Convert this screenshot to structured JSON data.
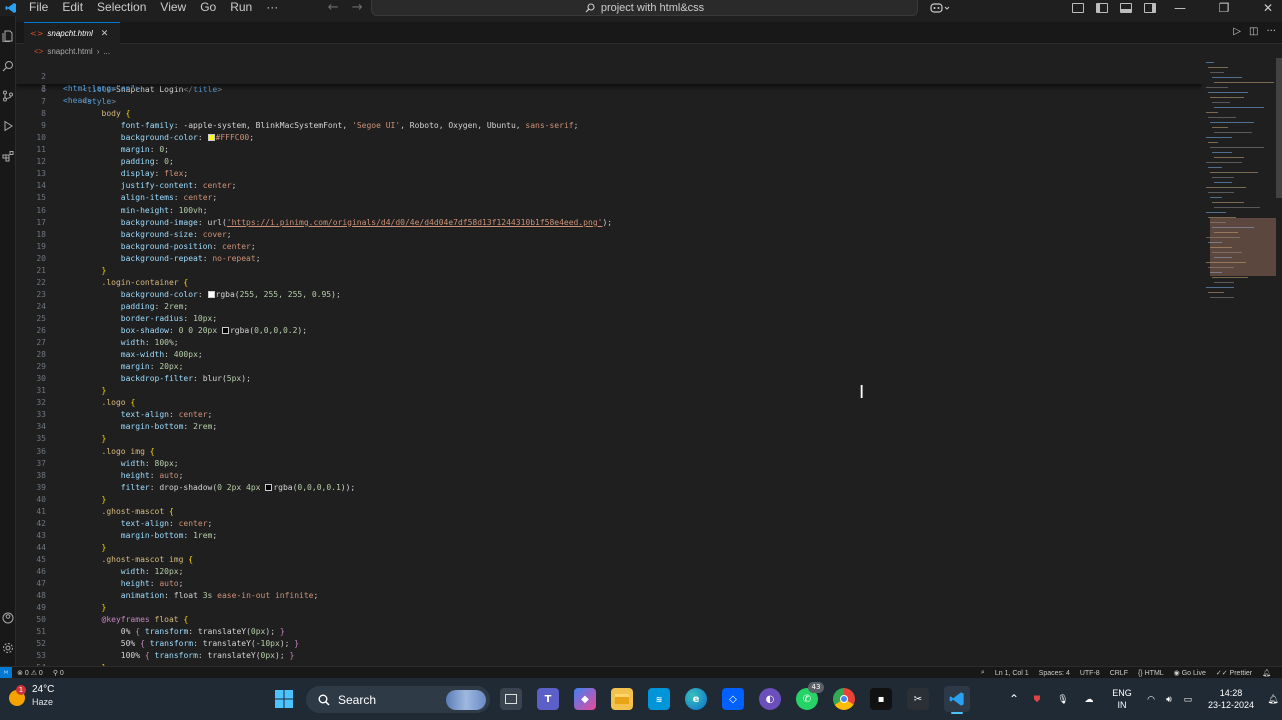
{
  "menu": [
    "File",
    "Edit",
    "Selection",
    "View",
    "Go",
    "Run"
  ],
  "command_center": {
    "title": "project with html&css"
  },
  "tab": {
    "filename": "snapcht.html"
  },
  "breadcrumb": [
    "snapcht.html",
    "›",
    "..."
  ],
  "sticky_lines": [
    {
      "ln": "2",
      "code": "<html lang=\"en\">"
    },
    {
      "ln": "3",
      "code": "<head>"
    }
  ],
  "lines": [
    {
      "ln": "6",
      "html": "    <span class='t'>&lt;</span><span class='tg'>title</span><span class='t'>&gt;</span><span class='plain'>Snapchat Login</span><span class='t'>&lt;/</span><span class='tg'>title</span><span class='t'>&gt;</span>"
    },
    {
      "ln": "7",
      "html": "    <span class='t'>&lt;</span><span class='tg'>style</span><span class='t'>&gt;</span>"
    },
    {
      "ln": "8",
      "html": "        <span class='s'>body</span> <span class='b'>{</span>"
    },
    {
      "ln": "9",
      "html": "            <span class='p'>font-family</span>: <span class='plain'>-apple-system, BlinkMacSystemFont, </span><span class='v'>'Segoe UI'</span><span class='plain'>, Roboto, Oxygen, Ubuntu, </span><span class='v'>sans-serif</span>;"
    },
    {
      "ln": "10",
      "html": "            <span class='p'>background-color</span>: <span class='sw' style='background:#FFFC00'></span><span class='v'>#FFFC00</span>;"
    },
    {
      "ln": "11",
      "html": "            <span class='p'>margin</span>: <span class='n'>0</span>;"
    },
    {
      "ln": "12",
      "html": "            <span class='p'>padding</span>: <span class='n'>0</span>;"
    },
    {
      "ln": "13",
      "html": "            <span class='p'>display</span>: <span class='v'>flex</span>;"
    },
    {
      "ln": "14",
      "html": "            <span class='p'>justify-content</span>: <span class='v'>center</span>;"
    },
    {
      "ln": "15",
      "html": "            <span class='p'>align-items</span>: <span class='v'>center</span>;"
    },
    {
      "ln": "16",
      "html": "            <span class='p'>min-height</span>: <span class='n'>100vh</span>;"
    },
    {
      "ln": "17",
      "html": "            <span class='p'>background-image</span>: <span class='plain'>url(</span><span class='u'>'https://i.pinimg.com/originals/d4/d0/4e/d4d04e7df58d13f1244310b1f58e4eed.png'</span><span class='plain'>)</span>;"
    },
    {
      "ln": "18",
      "html": "            <span class='p'>background-size</span>: <span class='v'>cover</span>;"
    },
    {
      "ln": "19",
      "html": "            <span class='p'>background-position</span>: <span class='v'>center</span>;"
    },
    {
      "ln": "20",
      "html": "            <span class='p'>background-repeat</span>: <span class='v'>no-repeat</span>;"
    },
    {
      "ln": "21",
      "html": "        <span class='b'>}</span>"
    },
    {
      "ln": "22",
      "html": "        <span class='s'>.login-container</span> <span class='b'>{</span>"
    },
    {
      "ln": "23",
      "html": "            <span class='p'>background-color</span>: <span class='sw' style='background:#ffffff'></span><span class='plain'>rgba(</span><span class='n'>255, 255, 255, 0.95</span><span class='plain'>)</span>;"
    },
    {
      "ln": "24",
      "html": "            <span class='p'>padding</span>: <span class='n'>2rem</span>;"
    },
    {
      "ln": "25",
      "html": "            <span class='p'>border-radius</span>: <span class='n'>10px</span>;"
    },
    {
      "ln": "26",
      "html": "            <span class='p'>box-shadow</span>: <span class='n'>0 0 20px</span> <span class='sw' style='background:#000'></span><span class='plain'>rgba(</span><span class='n'>0,0,0,0.2</span><span class='plain'>)</span>;"
    },
    {
      "ln": "27",
      "html": "            <span class='p'>width</span>: <span class='n'>100%</span>;"
    },
    {
      "ln": "28",
      "html": "            <span class='p'>max-width</span>: <span class='n'>400px</span>;"
    },
    {
      "ln": "29",
      "html": "            <span class='p'>margin</span>: <span class='n'>20px</span>;"
    },
    {
      "ln": "30",
      "html": "            <span class='p'>backdrop-filter</span>: <span class='plain'>blur(</span><span class='n'>5px</span><span class='plain'>)</span>;"
    },
    {
      "ln": "31",
      "html": "        <span class='b'>}</span>"
    },
    {
      "ln": "32",
      "html": "        <span class='s'>.logo</span> <span class='b'>{</span>"
    },
    {
      "ln": "33",
      "html": "            <span class='p'>text-align</span>: <span class='v'>center</span>;"
    },
    {
      "ln": "34",
      "html": "            <span class='p'>margin-bottom</span>: <span class='n'>2rem</span>;"
    },
    {
      "ln": "35",
      "html": "        <span class='b'>}</span>"
    },
    {
      "ln": "36",
      "html": "        <span class='s'>.logo img</span> <span class='b'>{</span>"
    },
    {
      "ln": "37",
      "html": "            <span class='p'>width</span>: <span class='n'>80px</span>;"
    },
    {
      "ln": "38",
      "html": "            <span class='p'>height</span>: <span class='v'>auto</span>;"
    },
    {
      "ln": "39",
      "html": "            <span class='p'>filter</span>: <span class='plain'>drop-shadow(</span><span class='n'>0 2px 4px</span> <span class='sw' style='background:#000'></span><span class='plain'>rgba(</span><span class='n'>0,0,0,0.1</span><span class='plain'>))</span>;"
    },
    {
      "ln": "40",
      "html": "        <span class='b'>}</span>"
    },
    {
      "ln": "41",
      "html": "        <span class='s'>.ghost-mascot</span> <span class='b'>{</span>"
    },
    {
      "ln": "42",
      "html": "            <span class='p'>text-align</span>: <span class='v'>center</span>;"
    },
    {
      "ln": "43",
      "html": "            <span class='p'>margin-bottom</span>: <span class='n'>1rem</span>;"
    },
    {
      "ln": "44",
      "html": "        <span class='b'>}</span>"
    },
    {
      "ln": "45",
      "html": "        <span class='s'>.ghost-mascot img</span> <span class='b'>{</span>"
    },
    {
      "ln": "46",
      "html": "            <span class='p'>width</span>: <span class='n'>120px</span>;"
    },
    {
      "ln": "47",
      "html": "            <span class='p'>height</span>: <span class='v'>auto</span>;"
    },
    {
      "ln": "48",
      "html": "            <span class='p'>animation</span>: <span class='plain'>float </span><span class='n'>3s</span> <span class='v'>ease-in-out infinite</span>;"
    },
    {
      "ln": "49",
      "html": "        <span class='b'>}</span>"
    },
    {
      "ln": "50",
      "html": "        <span class='at'>@keyframes</span> <span class='s'>float</span> <span class='b'>{</span>"
    },
    {
      "ln": "51",
      "html": "            <span class='plain'>0%</span> <span class='at'>{</span> <span class='p'>transform</span>: <span class='plain'>translateY(</span><span class='n'>0px</span><span class='plain'>)</span>; <span class='at'>}</span>"
    },
    {
      "ln": "52",
      "html": "            <span class='plain'>50%</span> <span class='at'>{</span> <span class='p'>transform</span>: <span class='plain'>translateY(</span><span class='n'>-10px</span><span class='plain'>)</span>; <span class='at'>}</span>"
    },
    {
      "ln": "53",
      "html": "            <span class='plain'>100%</span> <span class='at'>{</span> <span class='p'>transform</span>: <span class='plain'>translateY(</span><span class='n'>0px</span><span class='plain'>)</span>; <span class='at'>}</span>"
    },
    {
      "ln": "54",
      "html": "        <span class='b'>}</span>"
    }
  ],
  "status": {
    "errors": "0",
    "warnings": "0",
    "ports": "0",
    "position": "Ln 1, Col 1",
    "spaces": "Spaces: 4",
    "encoding": "UTF-8",
    "eol": "CRLF",
    "language": "HTML",
    "golive": "Go Live",
    "prettier": "Prettier"
  },
  "taskbar": {
    "weather_temp": "24°C",
    "weather_cond": "Haze",
    "weather_badge": "1",
    "search_label": "Search",
    "whatsapp_badge": "43",
    "lang_top": "ENG",
    "lang_bottom": "IN",
    "time": "14:28",
    "date": "23-12-2024"
  },
  "colors": {
    "accent": "#0078d4",
    "editor_bg": "#1f1f1f",
    "taskbar_bg": "#202a35"
  }
}
